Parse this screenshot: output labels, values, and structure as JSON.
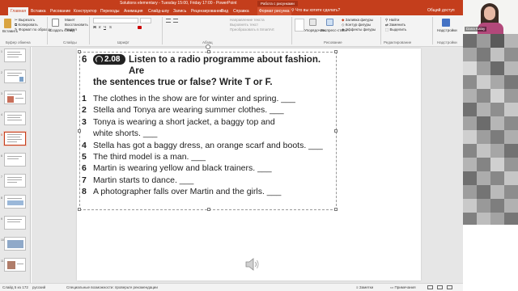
{
  "titlebar": {
    "title": "Solutions elementary - Tuesday 15:00, Friday 17:00 -  PowerPoint"
  },
  "tabs": {
    "file": "",
    "home": "Главная",
    "insert": "Вставка",
    "draw": "Рисование",
    "design": "Конструктор",
    "transitions": "Переходы",
    "animations": "Анимация",
    "slideshow": "Слайд-шоу",
    "review": "Запись",
    "record": "Рецензирование",
    "view": "Вид",
    "help": "Справка",
    "format": "Формат рисунка",
    "tell_me": "Что вы хотите сделать?",
    "work_with": "Работа с рисунками",
    "share": "Общий доступ"
  },
  "ribbon": {
    "paste": "Вставить",
    "cut": "Вырезать",
    "copy": "Копировать",
    "format_painter": "Формат по образцу",
    "new_slide": "Создать слайд",
    "layout": "Макет",
    "reset": "Восстановить",
    "section": "Раздел",
    "group_clipboard": "Буфер обмена",
    "group_slides": "Слайды",
    "group_font": "Шрифт",
    "group_paragraph": "Абзац",
    "group_drawing": "Рисование",
    "group_editing": "Редактирование",
    "group_addins": "Надстройки",
    "text_direction": "Направление текста",
    "align_text": "Выровнять текст",
    "convert_smartart": "Преобразовать в SmartArt",
    "arrange": "Упорядочить",
    "quick_styles": "Экспресс-стили",
    "shape_fill": "Заливка фигуры",
    "shape_outline": "Контур фигуры",
    "shape_effects": "Эффекты фигуры",
    "find": "Найти",
    "replace": "Заменить",
    "select": "Выделить",
    "addins": "Надстройки"
  },
  "exercise": {
    "number": "6",
    "track": "2.08",
    "instruction_line1": "Listen to a radio programme about fashion. Are",
    "instruction_line2": "the sentences true or false? Write T or F.",
    "items": [
      {
        "n": "1",
        "text": "The clothes in the show are for winter and spring. ___"
      },
      {
        "n": "2",
        "text": "Stella and Tonya are wearing summer clothes. ___"
      },
      {
        "n": "3",
        "text": "Tonya is wearing a short jacket, a baggy top and",
        "cont": "white shorts. ___"
      },
      {
        "n": "4",
        "text": "Stella has got a baggy dress, an orange scarf and boots. ___"
      },
      {
        "n": "5",
        "text": "The third model is a man. ___"
      },
      {
        "n": "6",
        "text": "Martin is wearing yellow and black trainers. ___"
      },
      {
        "n": "7",
        "text": "Martin starts to dance. ___"
      },
      {
        "n": "8",
        "text": "A photographer falls over Martin and the girls. ___"
      }
    ]
  },
  "status": {
    "slide_info": "Слайд 5 из 172",
    "language": "русский",
    "accessibility": "Специальные возможности: проверьте рекомендации",
    "notes": "Заметки",
    "comments": "Примечания"
  },
  "video": {
    "participant_name": "Dana Kalay"
  },
  "colors": {
    "accent": "#c43e1c",
    "ribbon_bg": "#f3f3f3",
    "canvas_bg": "#e6e6e6"
  }
}
